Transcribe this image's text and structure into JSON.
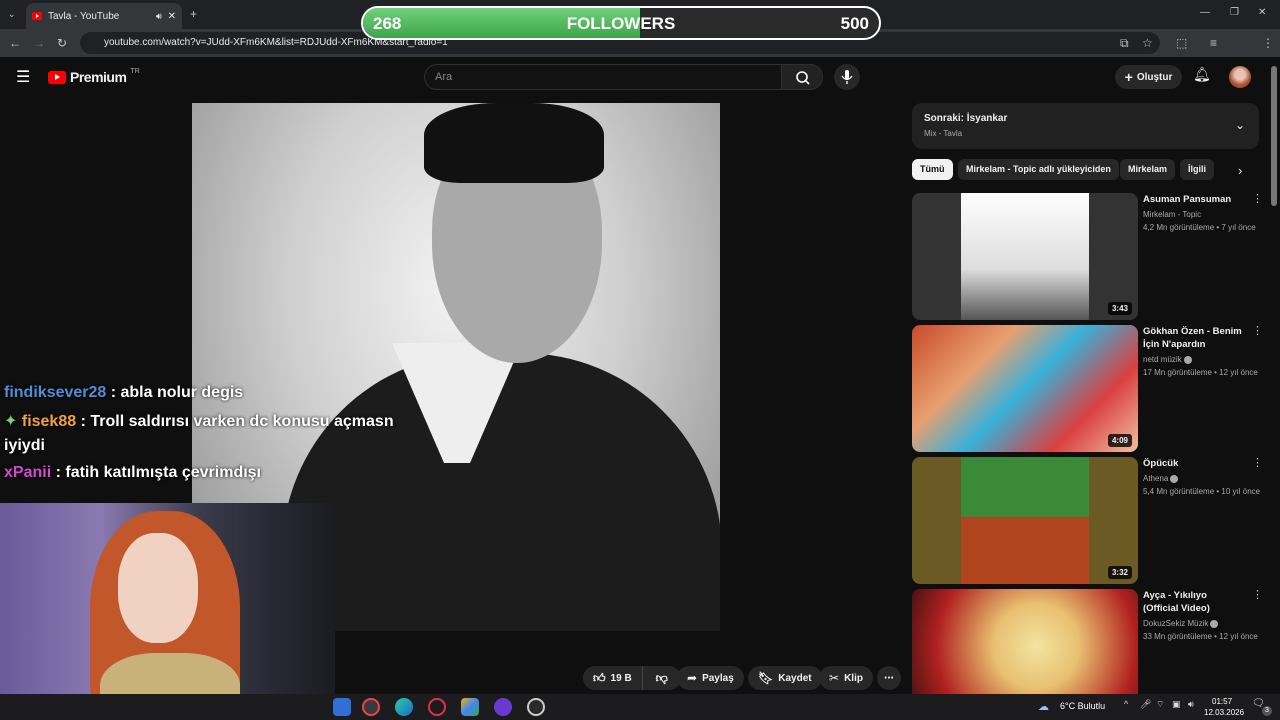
{
  "browser": {
    "tab_title": "Tavla - YouTube",
    "url": "youtube.com/watch?v=JUdd-XFm6KM&list=RDJUdd-XFm6KM&start_radio=1"
  },
  "youtube": {
    "logo": "Premium",
    "logo_region": "TR",
    "search_placeholder": "Ara",
    "create_label": "Oluştur"
  },
  "overlay": {
    "followers_current": "268",
    "followers_label": "FOLLOWERS",
    "followers_goal": "500",
    "followers_progress": 0.536,
    "chat": [
      {
        "user": "findiksever28",
        "user_color": "#4f8fd6",
        "message": ": abla nolur degis"
      },
      {
        "user": "fisek88",
        "user_color": "#f2a33a",
        "message": ": Troll saldırısı varken dc konusu açmasn",
        "message_cont": "iyiydi"
      },
      {
        "user": "xPanii",
        "user_color": "#d04bd0",
        "message": ": fatih katılmışta çevrimdışı"
      }
    ]
  },
  "actions": {
    "likes": "19 B",
    "share": "Paylaş",
    "save": "Kaydet",
    "clip": "Klip"
  },
  "sidebar": {
    "up_next_title": "Sonraki: İsyankar",
    "up_next_sub": "Mix - Tavla",
    "chips": [
      "Tümü",
      "Mirkelam - Topic adlı yükleyiciden",
      "Mirkelam",
      "İlgili"
    ],
    "recs": [
      {
        "title": "Asuman Pansuman",
        "channel": "Mirkelam - Topic",
        "meta": "4,2 Mn görüntüleme • 7 yıl önce",
        "duration": "3:43",
        "verified": false
      },
      {
        "title": "Gökhan Özen - Benim İçin N'apardın",
        "channel": "netd müzik",
        "meta": "17 Mn görüntüleme • 12 yıl önce",
        "duration": "4:09",
        "verified": true
      },
      {
        "title": "Öpücük",
        "channel": "Athena",
        "meta": "5,4 Mn görüntüleme • 10 yıl önce",
        "duration": "3:32",
        "verified": true
      },
      {
        "title": "Ayça - Yıkılıyo (Official Video)",
        "channel": "DokuzSekiz Müzik",
        "meta": "33 Mn görüntüleme • 12 yıl önce",
        "duration": "",
        "verified": true
      }
    ]
  },
  "taskbar": {
    "weather": "6°C  Bulutlu",
    "time": "01:57",
    "date": "12.03.2026",
    "notifications": "3"
  }
}
